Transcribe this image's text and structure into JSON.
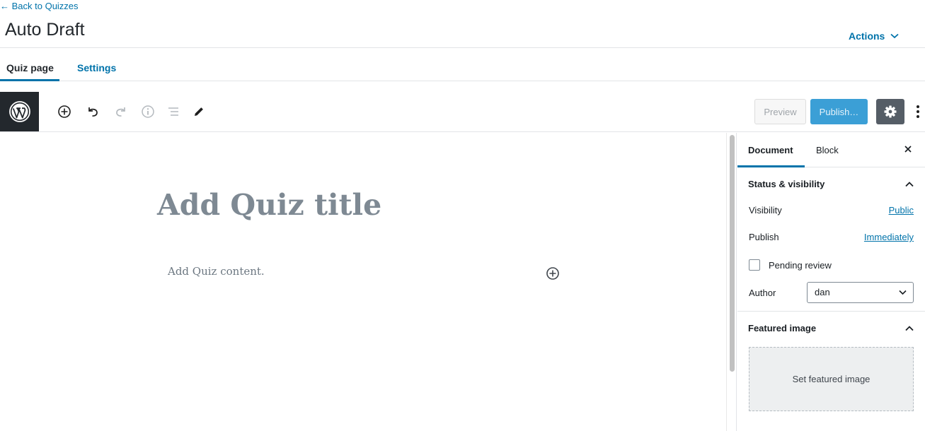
{
  "header": {
    "back_link": "← Back to Quizzes",
    "title": "Auto Draft",
    "actions_label": "Actions"
  },
  "tabs": [
    {
      "label": "Quiz page",
      "active": true
    },
    {
      "label": "Settings",
      "active": false
    }
  ],
  "toolbar": {
    "icons": [
      "wordpress-logo-icon",
      "add-block-icon",
      "undo-icon",
      "redo-icon",
      "info-icon",
      "outline-icon",
      "edit-icon"
    ],
    "preview_label": "Preview",
    "publish_label": "Publish…",
    "settings_icon": "gear-icon",
    "more_icon": "more-vertical-icon"
  },
  "editor": {
    "title_placeholder": "Add Quiz title",
    "content_placeholder": "Add Quiz content."
  },
  "sidebar": {
    "tabs": {
      "document": "Document",
      "block": "Block"
    },
    "status_panel": {
      "title": "Status & visibility",
      "visibility_label": "Visibility",
      "visibility_value": "Public",
      "publish_label": "Publish",
      "publish_value": "Immediately",
      "pending_label": "Pending review",
      "pending_checked": false,
      "author_label": "Author",
      "author_value": "dan"
    },
    "featured_panel": {
      "title": "Featured image",
      "button_label": "Set featured image"
    }
  },
  "colors": {
    "accent": "#0073aa",
    "publish_button": "#3b9fd6",
    "settings_button": "#555d66",
    "wp_logo_bg": "#23282d"
  }
}
